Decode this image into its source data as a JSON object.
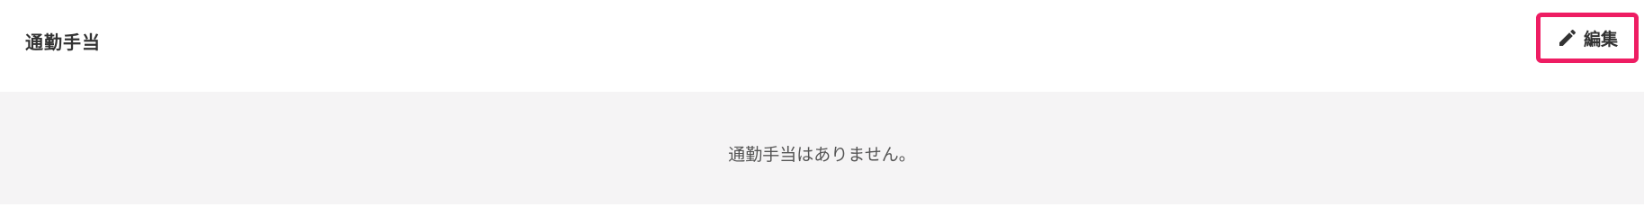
{
  "section": {
    "title": "通勤手当",
    "edit_button": {
      "label": "編集",
      "icon": "pencil-icon",
      "highlight_color": "#ee1d63"
    },
    "empty_message": "通勤手当はありません。"
  },
  "colors": {
    "body_background": "#f5f4f5",
    "text": "#333333"
  }
}
